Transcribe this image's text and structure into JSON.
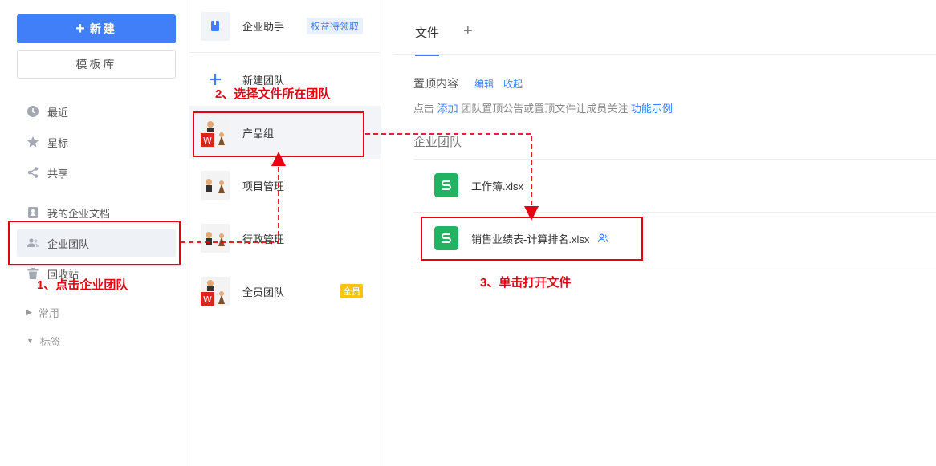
{
  "sidebar": {
    "new_button": "新建",
    "template_button": "模板库",
    "nav": [
      {
        "label": "最近",
        "icon": "clock-icon"
      },
      {
        "label": "星标",
        "icon": "star-icon"
      },
      {
        "label": "共享",
        "icon": "share-icon"
      },
      {
        "label": "我的企业文档",
        "icon": "document-icon"
      },
      {
        "label": "企业团队",
        "icon": "team-icon",
        "active": true
      },
      {
        "label": "回收站",
        "icon": "trash-icon"
      }
    ],
    "groups": [
      {
        "label": "常用",
        "expanded": false
      },
      {
        "label": "标签",
        "expanded": true
      }
    ]
  },
  "teams": {
    "items": [
      {
        "name": "企业助手",
        "badge": "权益待领取"
      },
      {
        "name": "新建团队"
      },
      {
        "name": "产品组",
        "selected": true
      },
      {
        "name": "项目管理"
      },
      {
        "name": "行政管理"
      },
      {
        "name": "全员团队",
        "badge": "全员"
      }
    ]
  },
  "main": {
    "tabs": {
      "file": "文件",
      "add": "+"
    },
    "pinned": {
      "title": "置顶内容",
      "edit": "编辑",
      "collapse": "收起",
      "desc_prefix": "点击",
      "add_link": "添加",
      "desc_middle": "团队置顶公告或置顶文件让成员关注",
      "example_link": "功能示例"
    },
    "section_title": "企业团队",
    "files": [
      {
        "name": "工作簿.xlsx",
        "icon": "spreadsheet-icon"
      },
      {
        "name": "销售业绩表-计算排名.xlsx",
        "icon": "spreadsheet-icon",
        "shared": true
      }
    ]
  },
  "annotations": {
    "step1": "1、点击企业团队",
    "step2": "2、选择文件所在团队",
    "step3": "3、单击打开文件",
    "color": "#e60012"
  },
  "colors": {
    "accent": "#417ff9",
    "spreadsheet": "#21b362",
    "badge_gold": "#f6c40c"
  }
}
